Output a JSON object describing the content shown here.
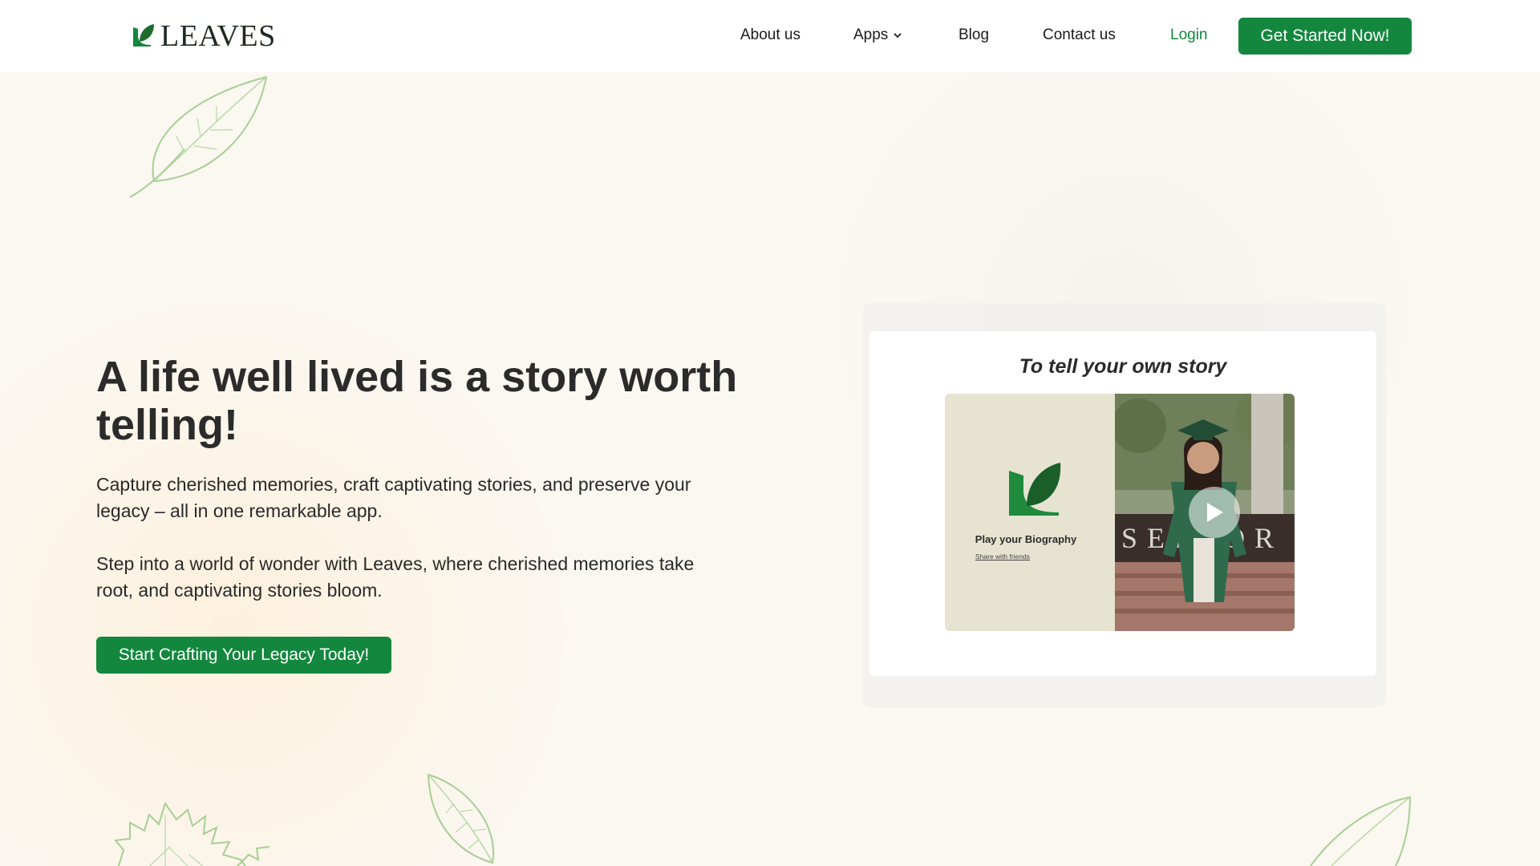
{
  "brand": {
    "name": "LEAVES",
    "accent": "#13873e"
  },
  "nav": {
    "about": "About us",
    "apps": "Apps",
    "blog": "Blog",
    "contact": "Contact us",
    "login": "Login",
    "get_started": "Get Started Now!"
  },
  "hero": {
    "headline": "A life well lived is a story worth telling!",
    "paragraph_1": "Capture cherished memories, craft captivating stories, and preserve your legacy – all in one remarkable app.",
    "paragraph_2": "Step into a world of wonder with Leaves, where cherished memories take root, and captivating stories bloom.",
    "cta": "Start Crafting Your Legacy Today!"
  },
  "video_card": {
    "title": "To tell your own story",
    "caption": "Play your Biography",
    "link": "Share with friends",
    "banner_text": "SENIOR"
  },
  "icons": {
    "logo": "leaf-logo-icon",
    "apps_dropdown": "chevron-down-icon",
    "play": "play-icon"
  }
}
